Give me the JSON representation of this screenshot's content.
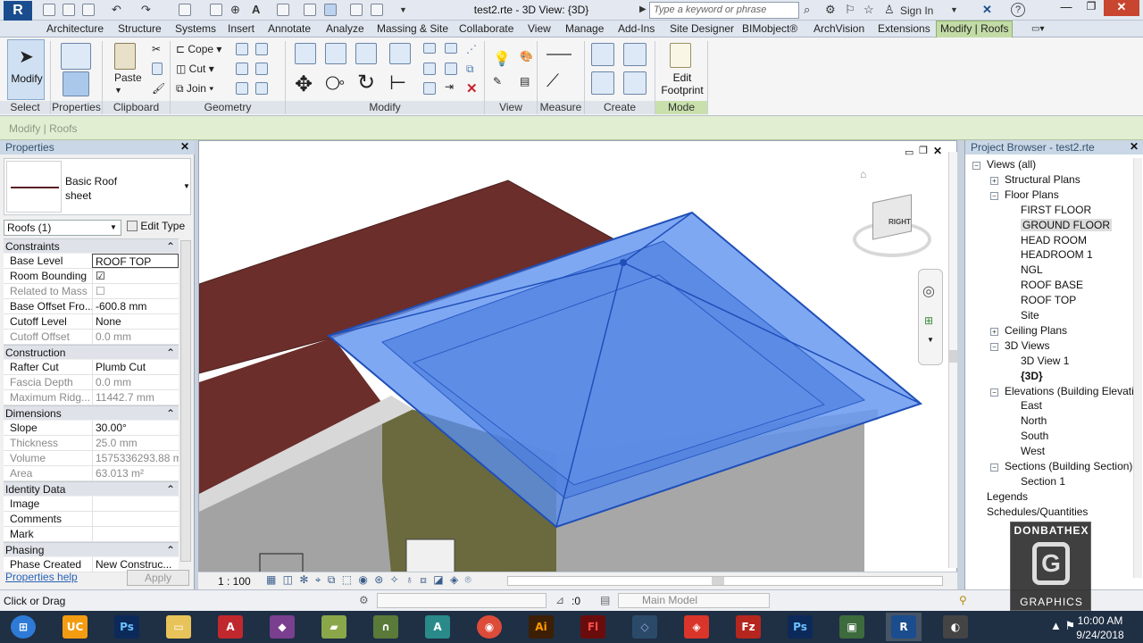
{
  "app": {
    "logo": "R",
    "doc_title": "test2.rte - 3D View: {3D}",
    "search_placeholder": "Type a keyword or phrase",
    "sign_in": "Sign In"
  },
  "menu": [
    "Architecture",
    "Structure",
    "Systems",
    "Insert",
    "Annotate",
    "Analyze",
    "Massing & Site",
    "Collaborate",
    "View",
    "Manage",
    "Add-Ins",
    "Site Designer",
    "BIMobject®",
    "ArchVision",
    "Extensions",
    "Modify | Roofs"
  ],
  "ribbon": {
    "modify": "Modify",
    "properties": "Properties",
    "paste": "Paste",
    "cope": "Cope",
    "cut": "Cut",
    "join": "Join",
    "edit_footprint_1": "Edit",
    "edit_footprint_2": "Footprint",
    "panels": [
      "Select",
      "Properties",
      "Clipboard",
      "Geometry",
      "Modify",
      "View",
      "Measure",
      "Create",
      "Mode"
    ]
  },
  "context_label": "Modify | Roofs",
  "properties": {
    "title": "Properties",
    "type_name_1": "Basic Roof",
    "type_name_2": "sheet",
    "selector": "Roofs (1)",
    "edit_type": "Edit Type",
    "sections": [
      {
        "name": "Constraints",
        "rows": [
          {
            "k": "Base Level",
            "v": "ROOF TOP"
          },
          {
            "k": "Room Bounding",
            "v": "☑"
          },
          {
            "k": "Related to Mass",
            "v": "☐"
          },
          {
            "k": "Base Offset Fro...",
            "v": "-600.8 mm"
          },
          {
            "k": "Cutoff Level",
            "v": "None"
          },
          {
            "k": "Cutoff Offset",
            "v": "0.0 mm"
          }
        ]
      },
      {
        "name": "Construction",
        "rows": [
          {
            "k": "Rafter Cut",
            "v": "Plumb Cut"
          },
          {
            "k": "Fascia Depth",
            "v": "0.0 mm"
          },
          {
            "k": "Maximum Ridg...",
            "v": "11442.7 mm"
          }
        ]
      },
      {
        "name": "Dimensions",
        "rows": [
          {
            "k": "Slope",
            "v": "30.00°"
          },
          {
            "k": "Thickness",
            "v": "25.0 mm"
          },
          {
            "k": "Volume",
            "v": "1575336293.88 m..."
          },
          {
            "k": "Area",
            "v": "63.013 m²"
          }
        ]
      },
      {
        "name": "Identity Data",
        "rows": [
          {
            "k": "Image",
            "v": ""
          },
          {
            "k": "Comments",
            "v": ""
          },
          {
            "k": "Mark",
            "v": ""
          }
        ]
      },
      {
        "name": "Phasing",
        "rows": [
          {
            "k": "Phase Created",
            "v": "New Construc..."
          }
        ]
      }
    ],
    "help": "Properties help",
    "apply": "Apply"
  },
  "viewport": {
    "scale": "1 : 100",
    "viewcube_face": "RIGHT"
  },
  "browser": {
    "title": "Project Browser - test2.rte",
    "items": [
      {
        "label": "Views (all)",
        "level": 0,
        "tog": "−"
      },
      {
        "label": "Structural Plans",
        "level": 1,
        "tog": "+"
      },
      {
        "label": "Floor Plans",
        "level": 1,
        "tog": "−"
      },
      {
        "label": "FIRST FLOOR",
        "level": 2
      },
      {
        "label": "GROUND FLOOR",
        "level": 2,
        "selected": true
      },
      {
        "label": "HEAD ROOM",
        "level": 2
      },
      {
        "label": "HEADROOM 1",
        "level": 2
      },
      {
        "label": "NGL",
        "level": 2
      },
      {
        "label": "ROOF BASE",
        "level": 2
      },
      {
        "label": "ROOF TOP",
        "level": 2
      },
      {
        "label": "Site",
        "level": 2
      },
      {
        "label": "Ceiling Plans",
        "level": 1,
        "tog": "+"
      },
      {
        "label": "3D Views",
        "level": 1,
        "tog": "−"
      },
      {
        "label": "3D View 1",
        "level": 2
      },
      {
        "label": "{3D}",
        "level": 2,
        "bold": true
      },
      {
        "label": "Elevations (Building Elevatic",
        "level": 1,
        "tog": "−"
      },
      {
        "label": "East",
        "level": 2
      },
      {
        "label": "North",
        "level": 2
      },
      {
        "label": "South",
        "level": 2
      },
      {
        "label": "West",
        "level": 2
      },
      {
        "label": "Sections (Building Section)",
        "level": 1,
        "tog": "−"
      },
      {
        "label": "Section 1",
        "level": 2
      },
      {
        "label": "Legends",
        "level": 0
      },
      {
        "label": "Schedules/Quantities",
        "level": 0
      }
    ]
  },
  "status": {
    "hint": "Click or Drag",
    "zero": ":0",
    "model": "Main Model"
  },
  "taskbar": {
    "time": "10:00 AM",
    "date": "9/24/2018"
  },
  "watermark": {
    "line1": "DONBATHEX",
    "line2": "GRAPHICS"
  },
  "colors": {
    "roof_selected": "#5b8ff0",
    "roof_brown": "#6b2e2a",
    "wall_olive": "#6a6a3e",
    "ribbon_context": "#c3dba6"
  }
}
